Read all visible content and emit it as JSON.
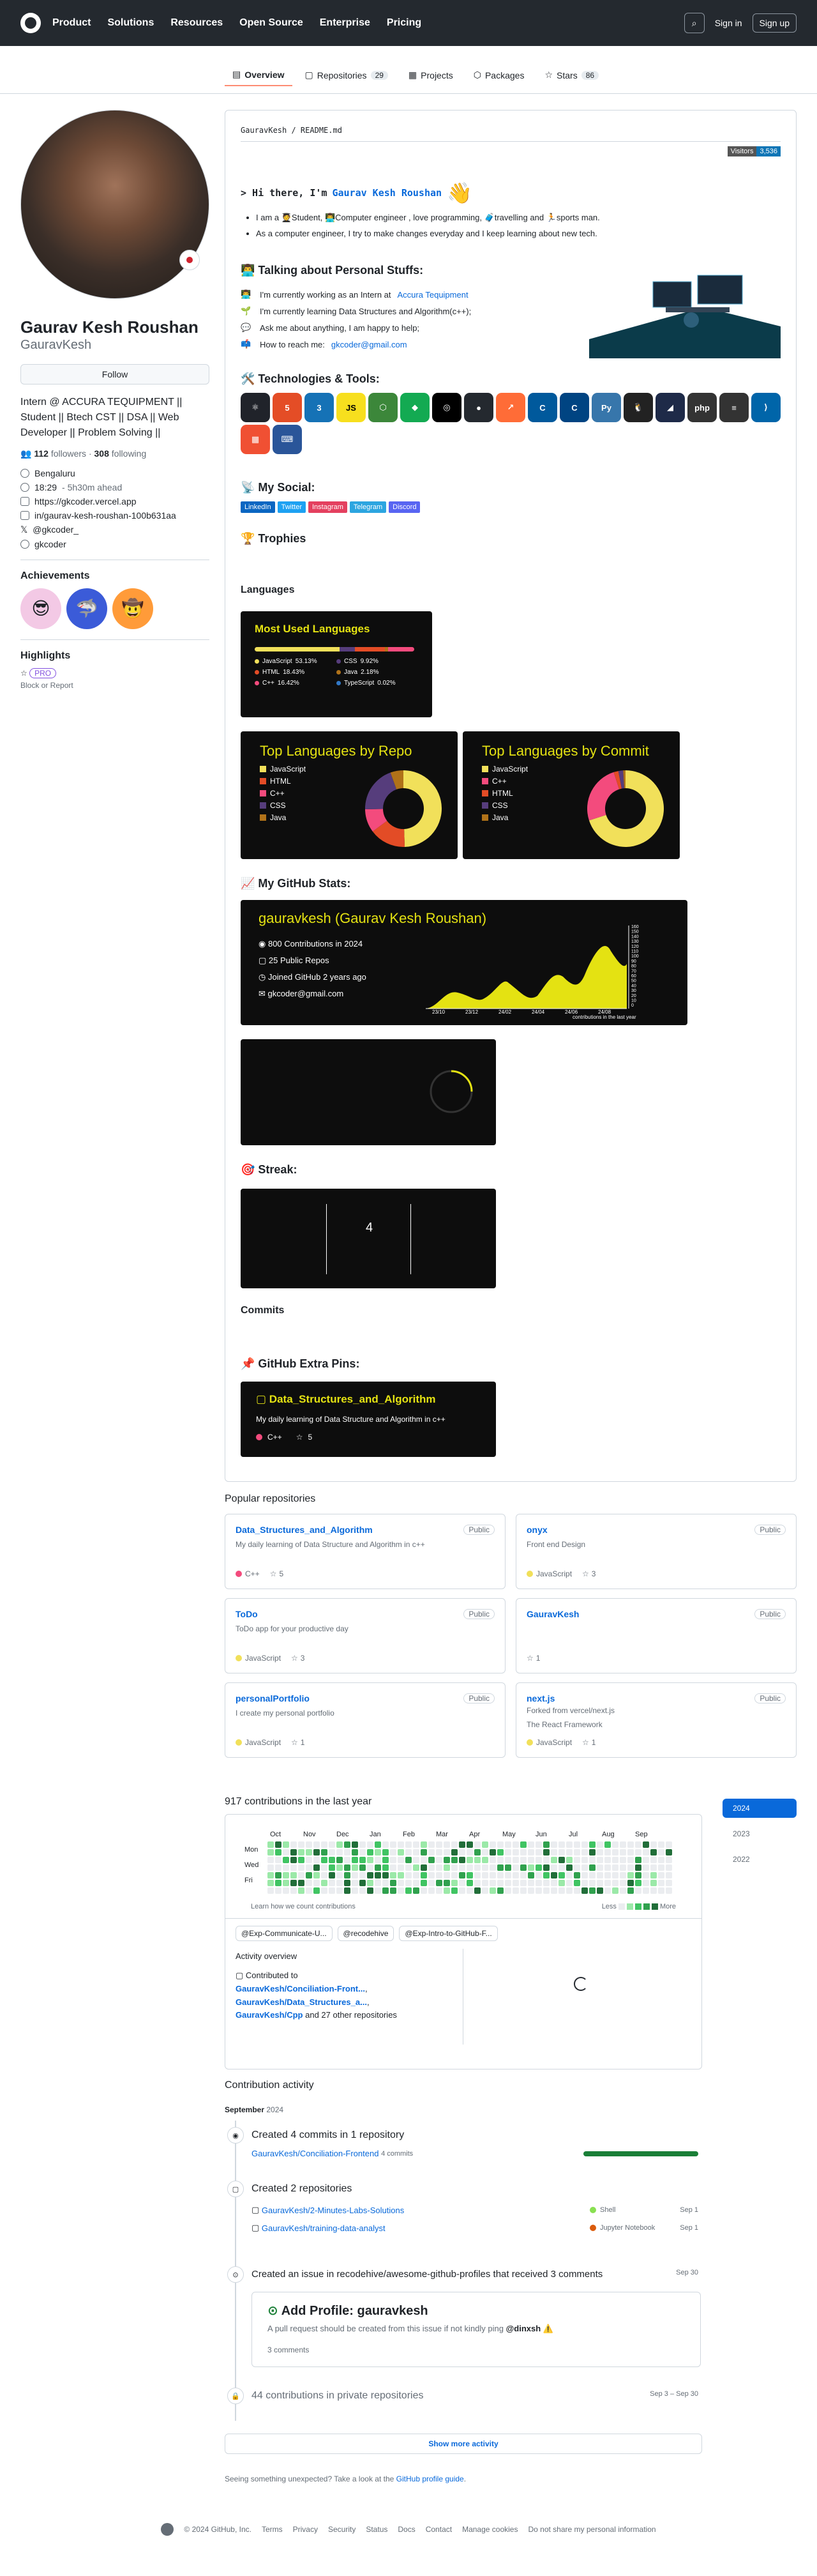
{
  "header": {
    "nav": [
      "Product",
      "Solutions",
      "Resources",
      "Open Source",
      "Enterprise",
      "Pricing"
    ],
    "sign_in": "Sign in",
    "sign_up": "Sign up"
  },
  "tabs": [
    {
      "label": "Overview",
      "count": ""
    },
    {
      "label": "Repositories",
      "count": "29"
    },
    {
      "label": "Projects",
      "count": ""
    },
    {
      "label": "Packages",
      "count": ""
    },
    {
      "label": "Stars",
      "count": "86"
    }
  ],
  "profile": {
    "name": "Gaurav Kesh Roushan",
    "login": "GauravKesh",
    "follow": "Follow",
    "bio": "Intern @ ACCURA TEQUIPMENT || Student || Btech CST || DSA || Web Developer || Problem Solving ||",
    "followers": "112",
    "followers_label": "followers",
    "following": "308",
    "following_label": "following",
    "location": "Bengaluru",
    "time": "18:29",
    "time_ahead": "- 5h30m ahead",
    "website": "https://gkcoder.vercel.app",
    "linkedin": "in/gaurav-kesh-roushan-100b631aa",
    "twitter": "@gkcoder_",
    "handle": "gkcoder",
    "achievements_title": "Achievements",
    "highlights_title": "Highlights",
    "pro": "PRO",
    "block": "Block or Report"
  },
  "readme": {
    "path": "GauravKesh / README.md",
    "visitors_label": "Visitors",
    "visitors_count": "3,536",
    "hello_prefix": "> Hi there, I'm",
    "hello_name": "Gaurav Kesh Roushan",
    "intro": [
      "I am a 🧑‍🎓Student, 👨‍💻Computer engineer , love programming, 🧳travelling and 🏃sports man.",
      "As a computer engineer, I try to make changes everyday and I keep learning about new tech."
    ],
    "talk_title": "👨‍💻 Talking about Personal Stuffs:",
    "talk": [
      {
        "icon": "👨‍💻",
        "text": "I'm currently working as an Intern at",
        "link": "Accura Tequipment"
      },
      {
        "icon": "🌱",
        "text": "I'm currently learning Data Structures and Algorithm(c++);",
        "link": ""
      },
      {
        "icon": "💬",
        "text": "Ask me about anything, I am happy to help;",
        "link": ""
      },
      {
        "icon": "📫",
        "text": "How to reach me:",
        "link": "gkcoder@gmail.com"
      }
    ],
    "tools_title": "🛠️ Technologies & Tools:",
    "tools": [
      {
        "label": "⚛",
        "color": "#20232a"
      },
      {
        "label": "5",
        "color": "#e44d26"
      },
      {
        "label": "3",
        "color": "#1572b6"
      },
      {
        "label": "JS",
        "color": "#f7df1e"
      },
      {
        "label": "⬡",
        "color": "#3c873a"
      },
      {
        "label": "◆",
        "color": "#13aa52"
      },
      {
        "label": "◎",
        "color": "#000000"
      },
      {
        "label": "●",
        "color": "#24292f"
      },
      {
        "label": "↗",
        "color": "#ff6c37"
      },
      {
        "label": "C",
        "color": "#00599c"
      },
      {
        "label": "C",
        "color": "#004482"
      },
      {
        "label": "Py",
        "color": "#3776ab"
      },
      {
        "label": "🐧",
        "color": "#222222"
      },
      {
        "label": "◢",
        "color": "#1e2a48"
      },
      {
        "label": "php",
        "color": "#333333"
      },
      {
        "label": "≡",
        "color": "#333333"
      },
      {
        "label": "⟩",
        "color": "#0065a9"
      },
      {
        "label": "▦",
        "color": "#f05033"
      },
      {
        "label": "⌨",
        "color": "#2a5599"
      }
    ],
    "social_title": "📡 My Social:",
    "social": [
      {
        "label": "LinkedIn",
        "color": "#0a66c2"
      },
      {
        "label": "Twitter",
        "color": "#1da1f2"
      },
      {
        "label": "Instagram",
        "color": "#e4405f"
      },
      {
        "label": "Telegram",
        "color": "#2ca5e0"
      },
      {
        "label": "Discord",
        "color": "#5865f2"
      }
    ],
    "trophies_title": "🏆 Trophies",
    "languages_title": "Languages",
    "most_used_title": "Most Used Languages",
    "most_used": [
      {
        "name": "JavaScript",
        "pct": "53.13%",
        "value": 53.13,
        "color": "#f1e05a"
      },
      {
        "name": "CSS",
        "pct": "9.92%",
        "value": 9.92,
        "color": "#563d7c"
      },
      {
        "name": "HTML",
        "pct": "18.43%",
        "value": 18.43,
        "color": "#e34c26"
      },
      {
        "name": "Java",
        "pct": "2.18%",
        "value": 2.18,
        "color": "#b07219"
      },
      {
        "name": "C++",
        "pct": "16.42%",
        "value": 16.42,
        "color": "#f34b7d"
      },
      {
        "name": "TypeScript",
        "pct": "0.02%",
        "value": 0.02,
        "color": "#3178c6"
      }
    ],
    "repo_title": "Top Languages by Repo",
    "commit_title": "Top Languages by Commit",
    "repo_langs": [
      {
        "name": "JavaScript",
        "color": "#f1e05a",
        "value": 45
      },
      {
        "name": "HTML",
        "color": "#e34c26",
        "value": 14
      },
      {
        "name": "C++",
        "color": "#f34b7d",
        "value": 9
      },
      {
        "name": "CSS",
        "color": "#563d7c",
        "value": 18
      },
      {
        "name": "Java",
        "color": "#b07219",
        "value": 5
      }
    ],
    "commit_langs": [
      {
        "name": "JavaScript",
        "color": "#f1e05a",
        "value": 70
      },
      {
        "name": "C++",
        "color": "#f34b7d",
        "value": 25
      },
      {
        "name": "HTML",
        "color": "#e34c26",
        "value": 2
      },
      {
        "name": "CSS",
        "color": "#563d7c",
        "value": 2
      },
      {
        "name": "Java",
        "color": "#b07219",
        "value": 1
      }
    ],
    "stats_title": "📈 My GitHub Stats:",
    "stats_card_title": "gauravkesh (Gaurav Kesh Roushan)",
    "stats": [
      "800 Contributions in 2024",
      "25 Public Repos",
      "Joined GitHub 2 years ago",
      "gkcoder@gmail.com"
    ],
    "stats_xlabel": "contributions in the last year",
    "stats_xticks": [
      "23/10",
      "23/12",
      "24/02",
      "24/04",
      "24/06",
      "24/08"
    ],
    "stats_yticks": [
      "160",
      "150",
      "140",
      "130",
      "120",
      "110",
      "100",
      "90",
      "80",
      "70",
      "60",
      "50",
      "40",
      "30",
      "20",
      "10",
      "0"
    ],
    "streak_title": "🎯 Streak:",
    "streak_value": "4",
    "commits_title": "Commits",
    "pins_title": "📌 GitHub Extra Pins:",
    "pin": {
      "name": "Data_Structures_and_Algorithm",
      "desc": "My daily learning of Data Structure and Algorithm in c++",
      "lang": "C++",
      "stars": "5"
    }
  },
  "popular_title": "Popular repositories",
  "repos": [
    {
      "name": "Data_Structures_and_Algorithm",
      "vis": "Public",
      "desc": "My daily learning of Data Structure and Algorithm in c++",
      "lang": "C++",
      "color": "#f34b7d",
      "stars": "5",
      "forked": ""
    },
    {
      "name": "onyx",
      "vis": "Public",
      "desc": "Front end Design",
      "lang": "JavaScript",
      "color": "#f1e05a",
      "stars": "3",
      "forked": ""
    },
    {
      "name": "ToDo",
      "vis": "Public",
      "desc": "ToDo app for your productive day",
      "lang": "JavaScript",
      "color": "#f1e05a",
      "stars": "3",
      "forked": ""
    },
    {
      "name": "GauravKesh",
      "vis": "Public",
      "desc": "",
      "lang": "",
      "color": "",
      "stars": "1",
      "forked": ""
    },
    {
      "name": "personalPortfolio",
      "vis": "Public",
      "desc": "I create my personal portfolio",
      "lang": "JavaScript",
      "color": "#f1e05a",
      "stars": "1",
      "forked": ""
    },
    {
      "name": "next.js",
      "vis": "Public",
      "desc": "The React Framework",
      "lang": "JavaScript",
      "color": "#f1e05a",
      "stars": "1",
      "forked": "Forked from vercel/next.js"
    }
  ],
  "contrib": {
    "title": "917 contributions in the last year",
    "months": [
      "Oct",
      "Nov",
      "Dec",
      "Jan",
      "Feb",
      "Mar",
      "Apr",
      "May",
      "Jun",
      "Jul",
      "Aug",
      "Sep"
    ],
    "days": [
      "Mon",
      "Wed",
      "Fri"
    ],
    "learn": "Learn how we count contributions",
    "less": "Less",
    "more": "More",
    "years": [
      "2024",
      "2023",
      "2022"
    ],
    "orgs": [
      "@Exp-Communicate-U...",
      "@recodehive",
      "@Exp-Intro-to-GitHub-F..."
    ],
    "overview_title": "Activity overview",
    "contributed_to": "Contributed to",
    "contributed_repos": [
      "GauravKesh/Conciliation-Front...",
      "GauravKesh/Data_Structures_a...",
      "GauravKesh/Cpp"
    ],
    "contributed_more": "and 27 other repositories"
  },
  "activity": {
    "title": "Contribution activity",
    "month": "September",
    "year": "2024",
    "commits_title": "Created 4 commits in 1 repository",
    "commits_repo": "GauravKesh/Conciliation-Frontend",
    "commits_count": "4 commits",
    "repos_title": "Created 2 repositories",
    "created": [
      {
        "name": "GauravKesh/2-Minutes-Labs-Solutions",
        "lang": "Shell",
        "color": "#89e051",
        "date": "Sep 1"
      },
      {
        "name": "GauravKesh/training-data-analyst",
        "lang": "Jupyter Notebook",
        "color": "#da5b0b",
        "date": "Sep 1"
      }
    ],
    "issue_title": "Created an issue in recodehive/awesome-github-profiles that received 3 comments",
    "issue_date": "Sep 30",
    "issue_name": "Add Profile: gauravkesh",
    "issue_body": "A pull request should be created from this issue if not kindly ping",
    "issue_mention": "@dinxsh",
    "issue_comments": "3 comments",
    "private_title": "44 contributions in private repositories",
    "private_date": "Sep 3 – Sep 30",
    "show_more": "Show more activity",
    "feedback": "Seeing something unexpected? Take a look at the",
    "feedback_link": "GitHub profile guide"
  },
  "footer": [
    "© 2024 GitHub, Inc.",
    "Terms",
    "Privacy",
    "Security",
    "Status",
    "Docs",
    "Contact",
    "Manage cookies",
    "Do not share my personal information"
  ]
}
